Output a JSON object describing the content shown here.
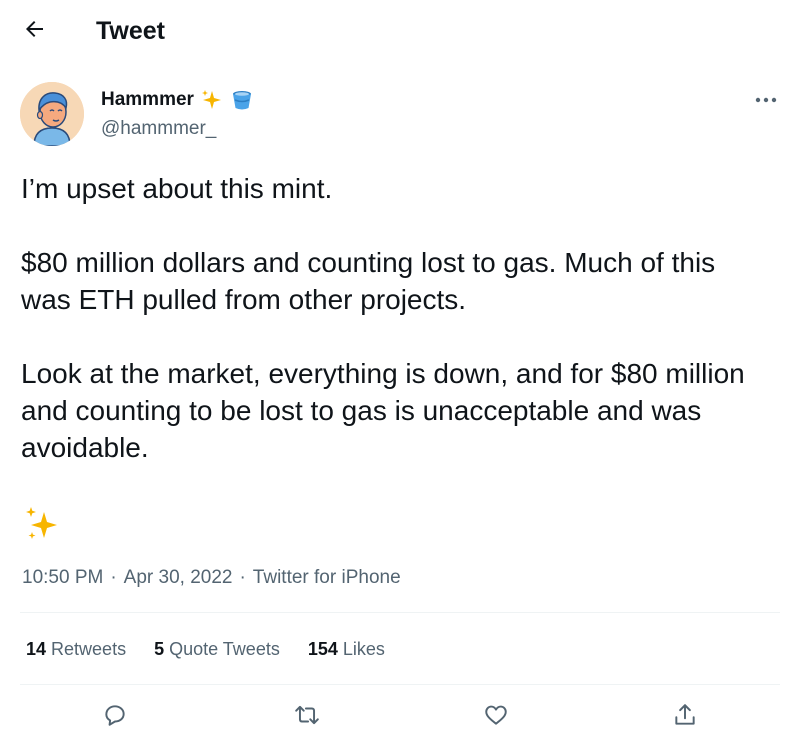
{
  "header": {
    "title": "Tweet",
    "back_icon": "arrow-left-icon"
  },
  "author": {
    "display_name": "Hammmer",
    "handle": "@hammmer_",
    "name_emojis": [
      "sparkles-icon",
      "bucket-icon"
    ],
    "avatar_bg": "#f7d8b6"
  },
  "tweet": {
    "paragraphs": [
      "I’m upset about this mint.",
      "$80 million dollars and counting lost to gas. Much of this was ETH pulled from other projects.",
      "Look at the market, everything is down, and for $80 million and counting to be lost to gas is unacceptable and was avoidable."
    ],
    "trailing_emoji": "sparkles-icon"
  },
  "meta": {
    "time": "10:50 PM",
    "separator": "·",
    "date": "Apr 30, 2022",
    "source": "Twitter for iPhone"
  },
  "stats": {
    "retweets_count": "14",
    "retweets_label": "Retweets",
    "quotes_count": "5",
    "quotes_label": "Quote Tweets",
    "likes_count": "154",
    "likes_label": "Likes"
  },
  "actions": [
    "reply-icon",
    "retweet-icon",
    "like-icon",
    "share-icon"
  ],
  "colors": {
    "text_primary": "#0f1419",
    "text_secondary": "#536471",
    "divider": "#eff3f4",
    "sparkle": "#f7b500"
  }
}
